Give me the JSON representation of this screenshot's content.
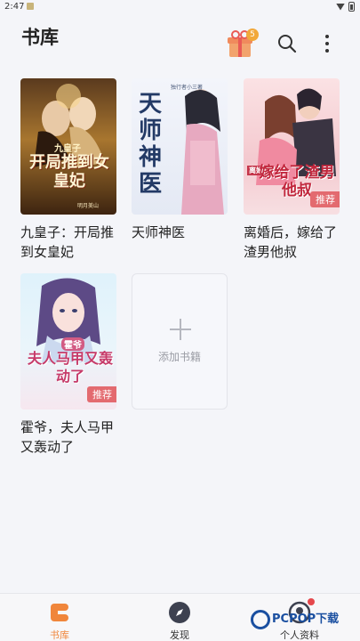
{
  "status": {
    "time": "2:47"
  },
  "header": {
    "title": "书库",
    "gift_badge": "5"
  },
  "books": [
    {
      "title": "九皇子：开局推到女皇妃",
      "cover_text": "开局推到女皇妃",
      "cover_sub": "九皇子",
      "author": "明月美山",
      "tag": ""
    },
    {
      "title": "天师神医",
      "cover_text": "天师神医",
      "cover_sub": "",
      "author": "独行者小三著",
      "tag": ""
    },
    {
      "title": "离婚后，嫁给了渣男他叔",
      "cover_text": "嫁给了渣男他叔",
      "cover_sub": "离婚后",
      "author": "",
      "tag": "推荐"
    },
    {
      "title": "霍爷，夫人马甲又轰动了",
      "cover_text": "夫人马甲又轰动了",
      "cover_sub": "霍爷",
      "author": "",
      "tag": "推荐"
    }
  ],
  "add_book": {
    "label": "添加书籍"
  },
  "nav": [
    {
      "label": "书库",
      "active": true
    },
    {
      "label": "发现",
      "active": false
    },
    {
      "label": "个人资料",
      "active": false
    }
  ],
  "watermark": {
    "text": "PCPOP下载"
  },
  "colors": {
    "accent": "#f0863b",
    "tag": "#e36a6f",
    "background": "#f4f5f9"
  }
}
